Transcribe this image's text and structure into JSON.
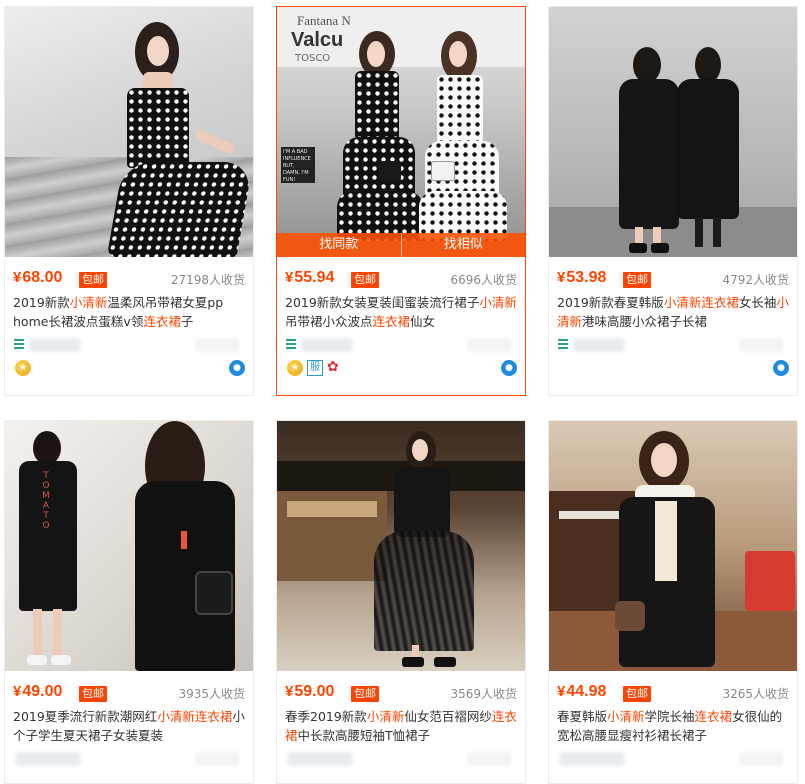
{
  "overlay": {
    "find_same": "找同款",
    "find_similar": "找相似"
  },
  "colors": {
    "accent": "#ff4400",
    "shop_icon": "#2ea07a",
    "wangwang": "#1e8be0"
  },
  "cards": [
    {
      "price_symbol": "¥",
      "price": "68.00",
      "tag": "包邮",
      "sales": "27198人收货",
      "title_parts": [
        "2019新款",
        "小清新",
        "温柔风吊带裙女夏pp home长裙波点蛋糕v领",
        "连衣裙",
        "子"
      ],
      "badges": [
        "gold-medal-icon",
        "wangwang-icon"
      ]
    },
    {
      "price_symbol": "¥",
      "price": "55.94",
      "tag": "包邮",
      "sales": "6696人收货",
      "title_parts": [
        "2019新款女装夏装闺蜜装流行裙子",
        "小清新",
        "吊带裙小众波点",
        "连衣裙",
        "仙女"
      ],
      "badges": [
        "gold-medal-icon",
        "clothing-badge-icon",
        "flower-badge-icon",
        "wangwang-icon"
      ],
      "photo_text": [
        "Fantana N",
        "Valcu",
        "TOSCO",
        "I'M A BAD INFLUENCE",
        "BUT, DAMN, I'M FUN!"
      ]
    },
    {
      "price_symbol": "¥",
      "price": "53.98",
      "tag": "包邮",
      "sales": "4792人收货",
      "title_parts": [
        "2019新款春夏韩版",
        "小清新连衣裙",
        "女长袖",
        "小清新",
        "港味高腰小众裙子长裙"
      ],
      "badges": [
        "wangwang-icon"
      ]
    },
    {
      "price_symbol": "¥",
      "price": "49.00",
      "tag": "包邮",
      "sales": "3935人收货",
      "title_parts": [
        "2019夏季流行新款潮网红",
        "小清新连衣裙",
        "小个子学生夏天裙子女装夏装"
      ],
      "badges": [],
      "photo_text": [
        "TOMATO"
      ]
    },
    {
      "price_symbol": "¥",
      "price": "59.00",
      "tag": "包邮",
      "sales": "3569人收货",
      "title_parts": [
        "春季2019新款",
        "小清新",
        "仙女范百褶网纱",
        "连衣裙",
        "中长款高腰短袖T恤裙子"
      ],
      "badges": []
    },
    {
      "price_symbol": "¥",
      "price": "44.98",
      "tag": "包邮",
      "sales": "3265人收货",
      "title_parts": [
        "春夏韩版",
        "小清新",
        "学院长袖",
        "连衣裙",
        "女很仙的宽松高腰显瘦衬衫裙长裙子"
      ],
      "badges": []
    }
  ]
}
